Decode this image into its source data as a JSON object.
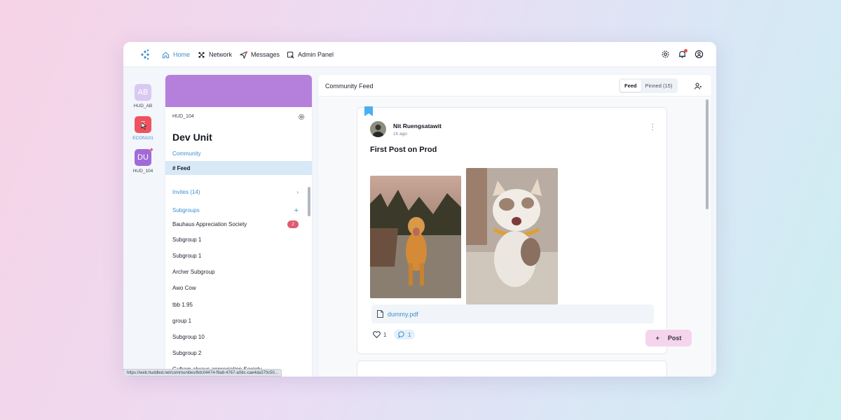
{
  "nav": {
    "items": [
      {
        "label": "Home",
        "icon": "home-icon",
        "active": true
      },
      {
        "label": "Network",
        "icon": "network-icon"
      },
      {
        "label": "Messages",
        "icon": "send-icon"
      },
      {
        "label": "Admin Panel",
        "icon": "admin-icon"
      }
    ],
    "right_icons": [
      "gear-icon",
      "bell-icon",
      "user-circle-icon"
    ]
  },
  "rail": {
    "items": [
      {
        "initials": "AB",
        "label": "HUD_AB",
        "color": "#d8c9f3"
      },
      {
        "initials": "E",
        "label": "ECON101",
        "color": "#f0515f",
        "active": true
      },
      {
        "initials": "DU",
        "label": "HUD_104",
        "color": "#a26ad8"
      }
    ]
  },
  "community": {
    "code": "HUD_104",
    "title": "Dev Unit",
    "community_label": "Community",
    "feed_label": "# Feed",
    "invites_label": "Invites (14)",
    "subgroups_label": "Subgroups",
    "subgroups": [
      {
        "name": "Bauhaus Appreciation Society",
        "badge": "2"
      },
      {
        "name": "Subgroup 1"
      },
      {
        "name": "Subgroup 1"
      },
      {
        "name": "Archer Subgroup"
      },
      {
        "name": "Awo Cow"
      },
      {
        "name": "tbb 1.95"
      },
      {
        "name": "group 1"
      },
      {
        "name": "Subgroup 10"
      },
      {
        "name": "Subgroup 2"
      },
      {
        "name": "Gufram always appreciation Society"
      }
    ],
    "banner_color": "#b57fdc"
  },
  "feed": {
    "title": "Community Feed",
    "tabs": [
      "Feed",
      "Pinned (15)"
    ],
    "post": {
      "author": "Nit Ruengsatawit",
      "time": "1h ago",
      "title": "First Post on Prod",
      "attachment": "dummy.pdf",
      "likes": "1",
      "comments": "1"
    },
    "post_button": "Post"
  },
  "status_url": "https://web.huddled.net/communities/8dc04474-f9a8-4767-a0dc-cae4da370c50...",
  "colors": {
    "accent": "#3d8fd1",
    "badge": "#e05a72"
  }
}
